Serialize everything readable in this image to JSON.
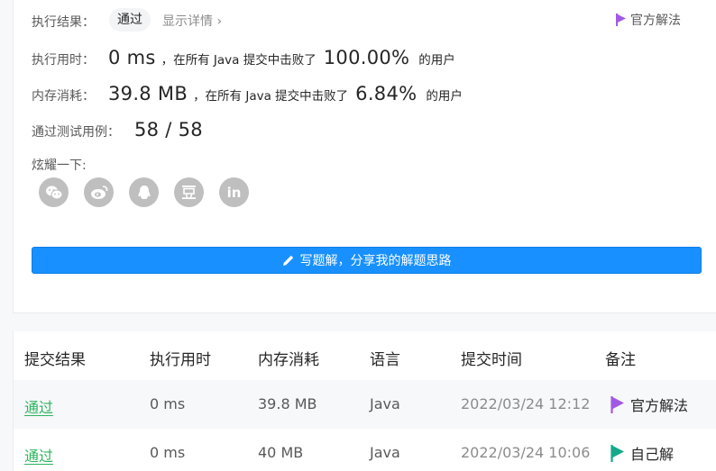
{
  "summary": {
    "result_label": "执行结果：",
    "result_value": "通过",
    "detail_link": "显示详情",
    "official_solution": "官方解法",
    "runtime_label": "执行用时：",
    "runtime_value": "0 ms",
    "runtime_text": "，在所有 Java 提交中击败了",
    "runtime_percent": "100.00%",
    "runtime_suffix": "的用户",
    "memory_label": "内存消耗：",
    "memory_value": "39.8 MB",
    "memory_text": "，在所有 Java 提交中击败了",
    "memory_percent": "6.84%",
    "memory_suffix": "的用户",
    "tests_label": "通过测试用例：",
    "tests_value": "58 / 58",
    "share_label": "炫耀一下:",
    "share_icons": [
      "wechat-icon",
      "weibo-icon",
      "qq-icon",
      "douban-icon",
      "linkedin-icon"
    ],
    "write_button": "写题解，分享我的解题思路"
  },
  "table": {
    "headers": [
      "提交结果",
      "执行用时",
      "内存消耗",
      "语言",
      "提交时间",
      "备注"
    ],
    "rows": [
      {
        "result": "通过",
        "runtime": "0 ms",
        "memory": "39.8 MB",
        "language": "Java",
        "time": "2022/03/24 12:12",
        "note": "官方解法",
        "flag_color": "#a259e6"
      },
      {
        "result": "通过",
        "runtime": "0 ms",
        "memory": "40 MB",
        "language": "Java",
        "time": "2022/03/24 10:06",
        "note": "自己解",
        "flag_color": "#13a98a"
      }
    ]
  },
  "colors": {
    "accent": "#1890ff",
    "pass": "#2db55d",
    "official_flag": "#a259e6"
  }
}
